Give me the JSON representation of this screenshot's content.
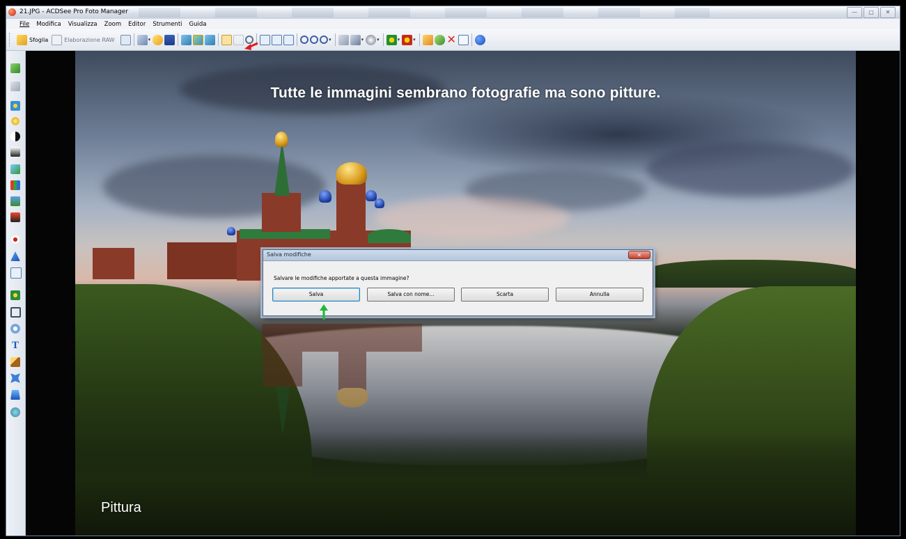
{
  "window": {
    "title": "21.JPG - ACDSee Pro Foto Manager",
    "controls": {
      "minimize": "—",
      "maximize": "▢",
      "close": "✕"
    }
  },
  "menu": {
    "items": [
      "File",
      "Modifica",
      "Visualizza",
      "Zoom",
      "Editor",
      "Strumenti",
      "Guida"
    ]
  },
  "toolbar": {
    "browse_label": "Sfoglia",
    "raw_label": "Elaborazione RAW"
  },
  "image": {
    "caption_top": "Tutte le immagini sembrano fotografie ma sono pitture.",
    "caption_bottom": "Pittura"
  },
  "dialog": {
    "title": "Salva modifiche",
    "message": "Salvare le modifiche apportate a questa immagine?",
    "buttons": [
      "Salva",
      "Salva con nome...",
      "Scarta",
      "Annulla"
    ],
    "close_glyph": "✕"
  },
  "colors": {
    "annotation_red": "#e01b1b",
    "annotation_green": "#1fb83a"
  }
}
